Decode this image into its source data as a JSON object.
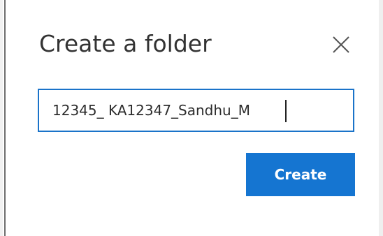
{
  "dialog": {
    "title": "Create a folder",
    "close_icon": "close-icon",
    "folder_name_value": "12345_ KA12347_Sandhu_M",
    "create_label": "Create"
  },
  "colors": {
    "accent": "#1575d1",
    "field_border": "#1a73c9",
    "title_text": "#333333",
    "background": "#ffffff"
  }
}
